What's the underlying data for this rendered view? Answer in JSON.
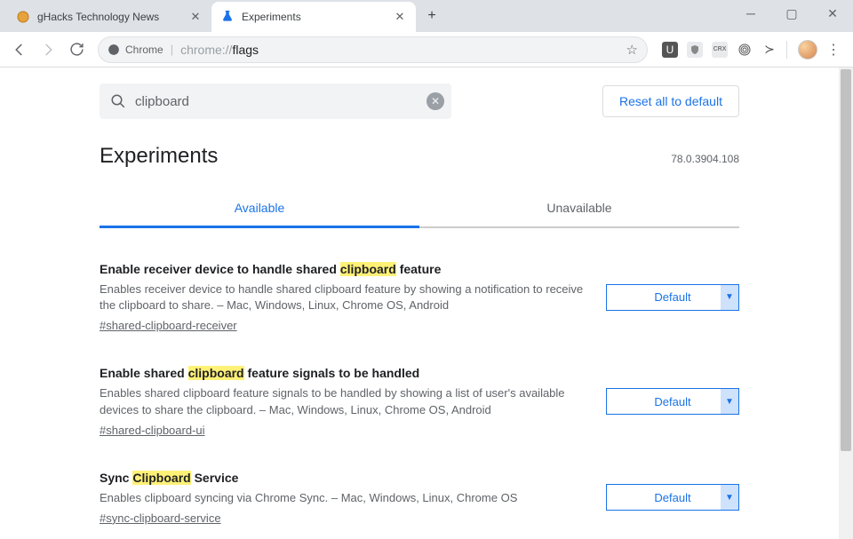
{
  "window": {
    "tabs": [
      {
        "title": "gHacks Technology News",
        "active": false
      },
      {
        "title": "Experiments",
        "active": true
      }
    ]
  },
  "omnibox": {
    "security_label": "Chrome",
    "url_prefix": "chrome://",
    "url_path": "flags"
  },
  "page": {
    "search": {
      "value": "clipboard"
    },
    "reset_label": "Reset all to default",
    "heading": "Experiments",
    "version": "78.0.3904.108",
    "tabs": {
      "available": "Available",
      "unavailable": "Unavailable"
    },
    "select_default": "Default"
  },
  "flags": [
    {
      "title_parts": [
        "Enable receiver device to handle shared ",
        "clipboard",
        " feature"
      ],
      "desc": "Enables receiver device to handle shared clipboard feature by showing a notification to receive the clipboard to share. – Mac, Windows, Linux, Chrome OS, Android",
      "link": "#shared-clipboard-receiver"
    },
    {
      "title_parts": [
        "Enable shared ",
        "clipboard",
        " feature signals to be handled"
      ],
      "desc": "Enables shared clipboard feature signals to be handled by showing a list of user's available devices to share the clipboard. – Mac, Windows, Linux, Chrome OS, Android",
      "link": "#shared-clipboard-ui"
    },
    {
      "title_parts": [
        "Sync ",
        "Clipboard",
        " Service"
      ],
      "desc": "Enables clipboard syncing via Chrome Sync. – Mac, Windows, Linux, Chrome OS",
      "link": "#sync-clipboard-service"
    }
  ]
}
